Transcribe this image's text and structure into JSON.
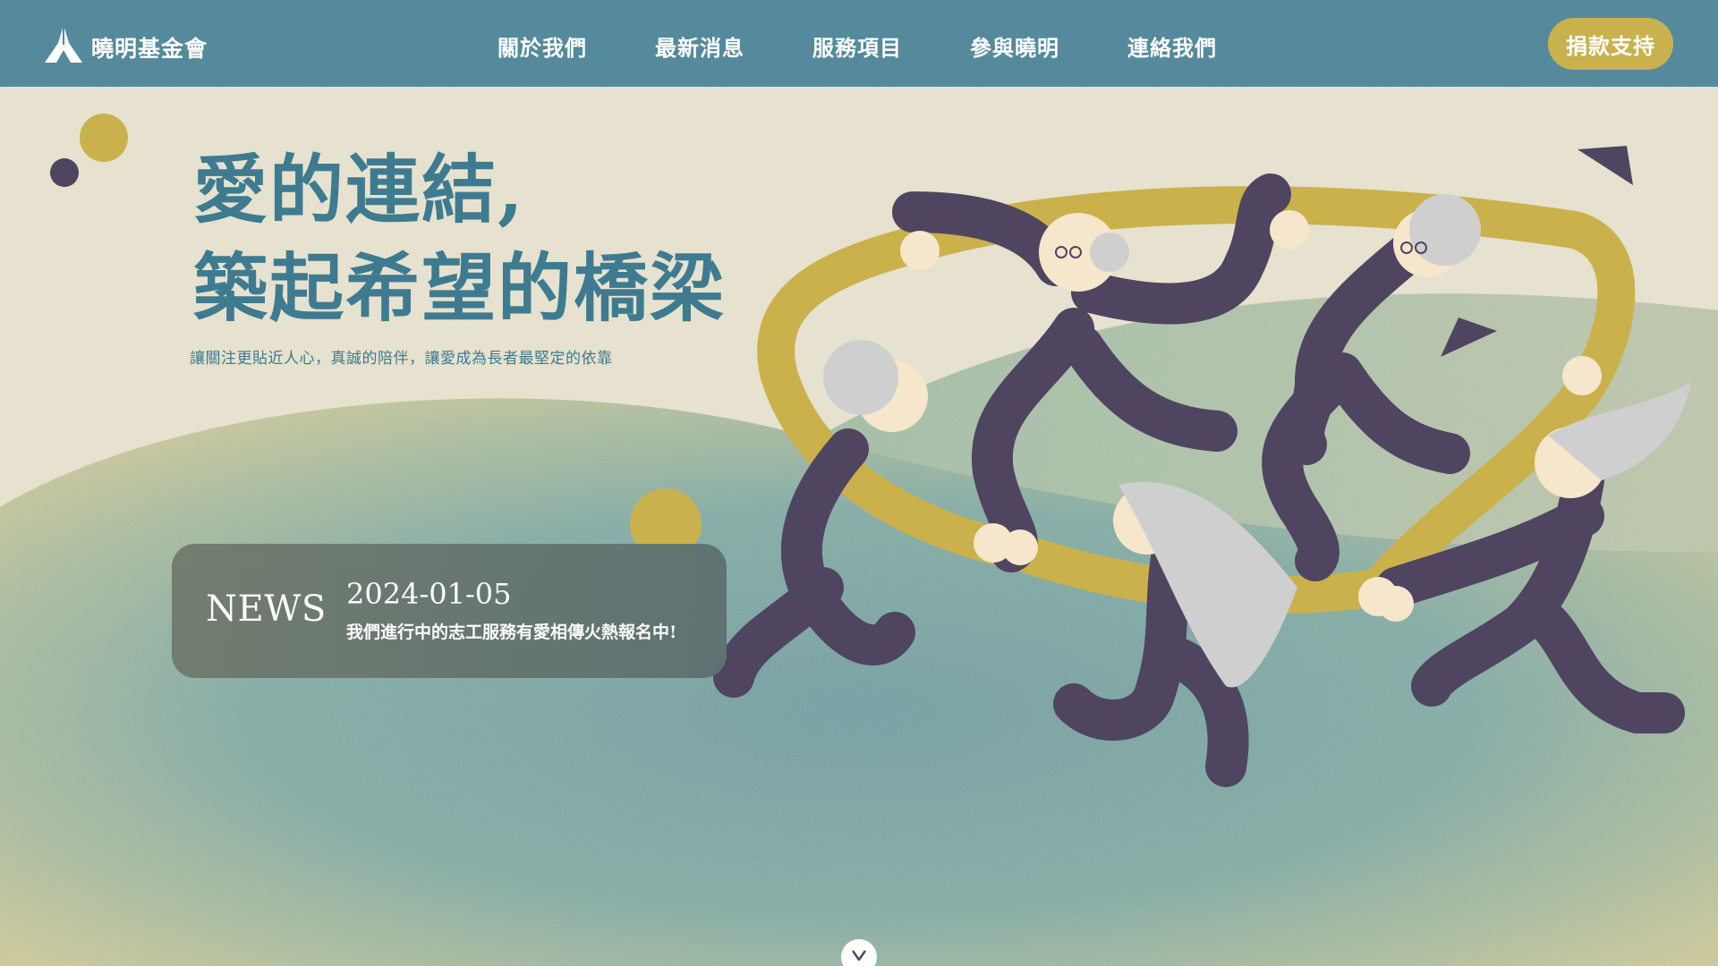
{
  "brand": {
    "name": "曉明基金會",
    "logo_icon": "mountain-logo-icon"
  },
  "nav": {
    "items": [
      {
        "label": "關於我們"
      },
      {
        "label": "最新消息"
      },
      {
        "label": "服務項目"
      },
      {
        "label": "參與曉明"
      },
      {
        "label": "連絡我們"
      }
    ],
    "donate_label": "捐款支持"
  },
  "hero": {
    "headline_line1": "愛的連結,",
    "headline_line2": "築起希望的橋梁",
    "subline": "讓關注更貼近人心，真誠的陪伴，讓愛成為長者最堅定的依靠",
    "illustration": "elderly-people-dancing-holding-ring-illustration"
  },
  "news": {
    "label": "NEWS",
    "date": "2024-01-05",
    "title": "我們進行中的志工服務有愛相傳火熱報名中!"
  },
  "scroll": {
    "icon": "chevron-down-icon"
  },
  "colors": {
    "navbar": "#548a9c",
    "accent_gold": "#c9b24e",
    "headline_teal": "#3e7b90",
    "figure_purple": "#4f4560",
    "background_cream": "#e3dfca"
  }
}
